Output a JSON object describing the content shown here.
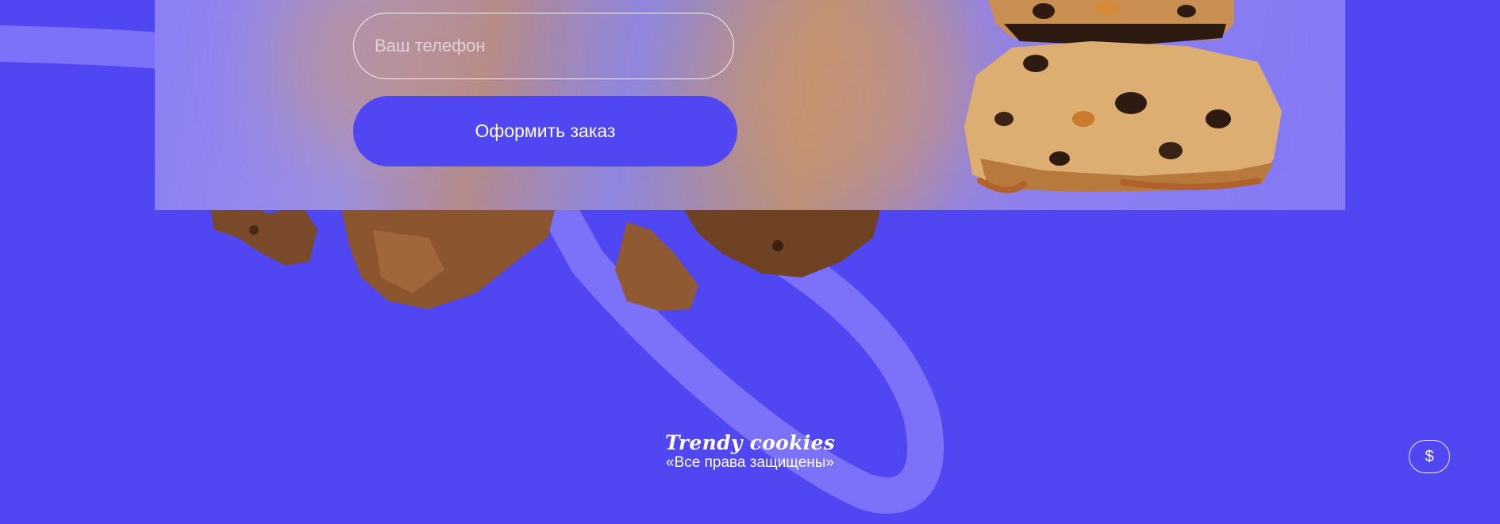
{
  "order_form": {
    "phone_placeholder": "Ваш телефон",
    "submit_label": "Оформить заказ"
  },
  "footer": {
    "brand": "Trendy cookies",
    "copyright": "«Все права защищены»"
  },
  "currency_button": {
    "label": "$"
  },
  "colors": {
    "background": "#5046f2",
    "accent_button": "#5046f2",
    "panel": "#8a7ff5"
  },
  "icons": [
    "cookie-crumbs-image",
    "cookie-stack-image",
    "swoosh-decoration"
  ]
}
